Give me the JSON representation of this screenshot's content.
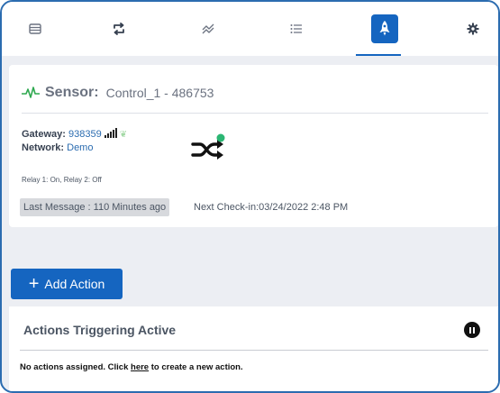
{
  "toolbar": {
    "items": [
      {
        "name": "list-view",
        "icon": "card-stack-icon"
      },
      {
        "name": "repeat",
        "icon": "repeat-icon"
      },
      {
        "name": "chart",
        "icon": "trend-lines-icon"
      },
      {
        "name": "list",
        "icon": "bullet-list-icon"
      },
      {
        "name": "actions",
        "icon": "rocket-icon",
        "active": true
      },
      {
        "name": "settings",
        "icon": "gear-icon"
      }
    ]
  },
  "sensor": {
    "label": "Sensor:",
    "name": "Control_1 - 486753",
    "gateway_label": "Gateway:",
    "gateway_value": "938359",
    "network_label": "Network:",
    "network_value": "Demo",
    "relay_status": "Relay 1: On, Relay 2: Off",
    "last_message": "Last Message : 110 Minutes ago",
    "next_checkin": "Next Check-in:03/24/2022 2:48 PM"
  },
  "add_action": {
    "label": "Add Action"
  },
  "actions_panel": {
    "title": "Actions Triggering Active",
    "empty_prefix": "No actions assigned. Click ",
    "empty_link": "here",
    "empty_suffix": " to create a new action."
  },
  "colors": {
    "accent": "#1565c0",
    "pulse": "#2ea84f",
    "status_dot": "#2bb673",
    "frame_border": "#2b6cb0"
  }
}
